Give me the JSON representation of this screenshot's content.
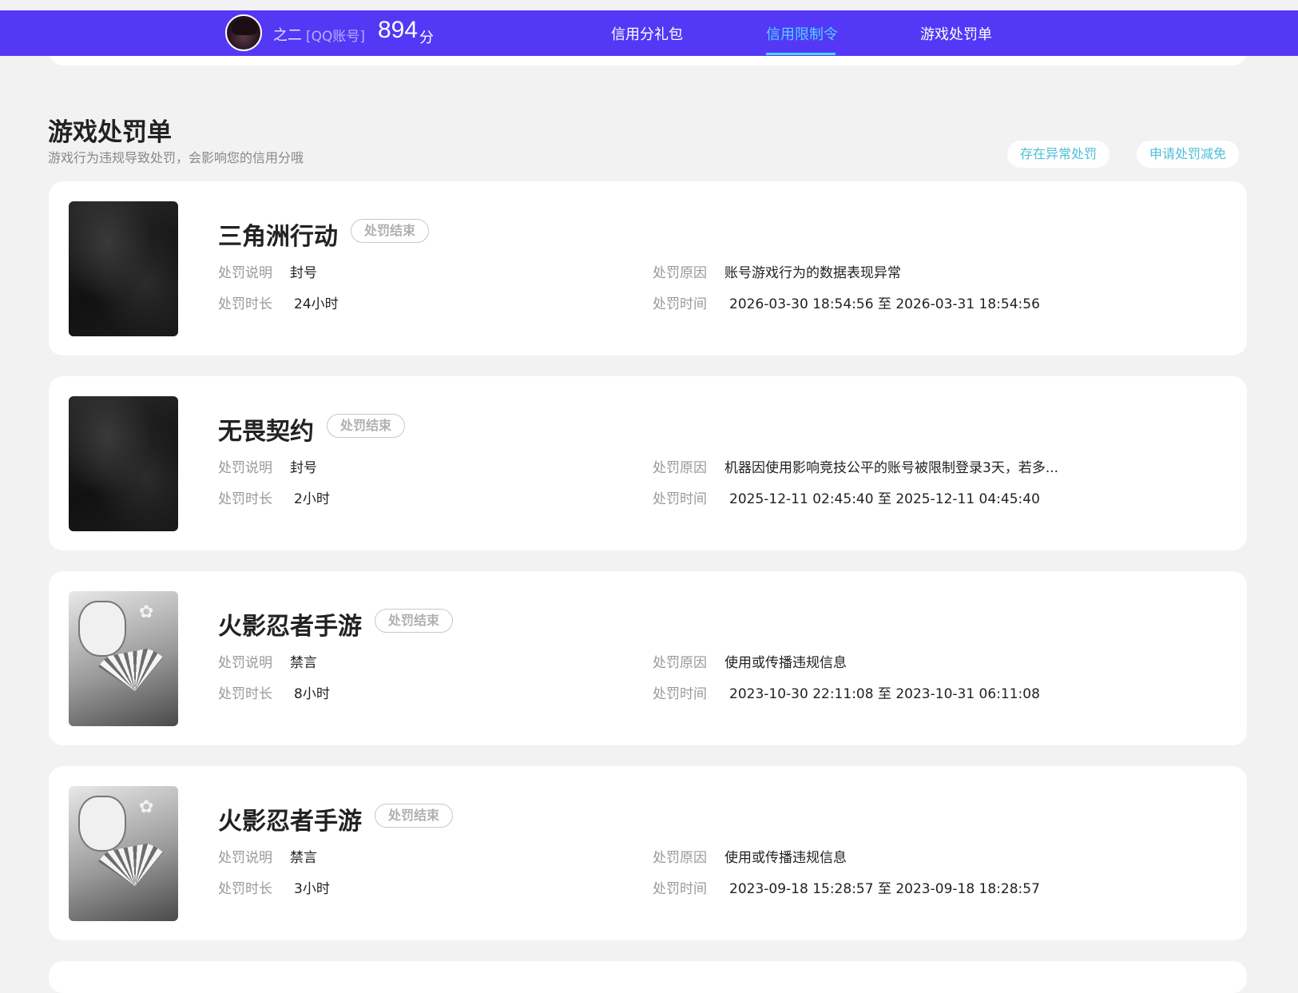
{
  "header": {
    "username": "之二",
    "account_type": "[QQ账号]",
    "score": "894",
    "score_unit": "分",
    "nav": [
      {
        "label": "信用分礼包",
        "active": false
      },
      {
        "label": "信用限制令",
        "active": true
      },
      {
        "label": "游戏处罚单",
        "active": false
      }
    ]
  },
  "section": {
    "title": "游戏处罚单",
    "subtitle": "游戏行为违规导致处罚，会影响您的信用分哦",
    "actions": [
      "存在异常处罚",
      "申请处罚减免"
    ]
  },
  "labels": {
    "desc": "处罚说明",
    "duration": "处罚时长",
    "reason": "处罚原因",
    "time": "处罚时间"
  },
  "records": [
    {
      "game": "三角洲行动",
      "status": "处罚结束",
      "desc": "封号",
      "duration": "24小时",
      "reason": "账号游戏行为的数据表现异常",
      "time": "2026-03-30 18:54:56 至 2026-03-31 18:54:56",
      "thumb": "dark-forest"
    },
    {
      "game": "无畏契约",
      "status": "处罚结束",
      "desc": "封号",
      "duration": "2小时",
      "reason": "机器因使用影响竞技公平的账号被限制登录3天，若多...",
      "time": "2025-12-11 02:45:40 至 2025-12-11 04:45:40",
      "thumb": "dark-forest"
    },
    {
      "game": "火影忍者手游",
      "status": "处罚结束",
      "desc": "禁言",
      "duration": "8小时",
      "reason": "使用或传播违规信息",
      "time": "2023-10-30 22:11:08 至 2023-10-31 06:11:08",
      "thumb": "anime-fan"
    },
    {
      "game": "火影忍者手游",
      "status": "处罚结束",
      "desc": "禁言",
      "duration": "3小时",
      "reason": "使用或传播违规信息",
      "time": "2023-09-18 15:28:57 至 2023-09-18 18:28:57",
      "thumb": "anime-fan"
    }
  ]
}
